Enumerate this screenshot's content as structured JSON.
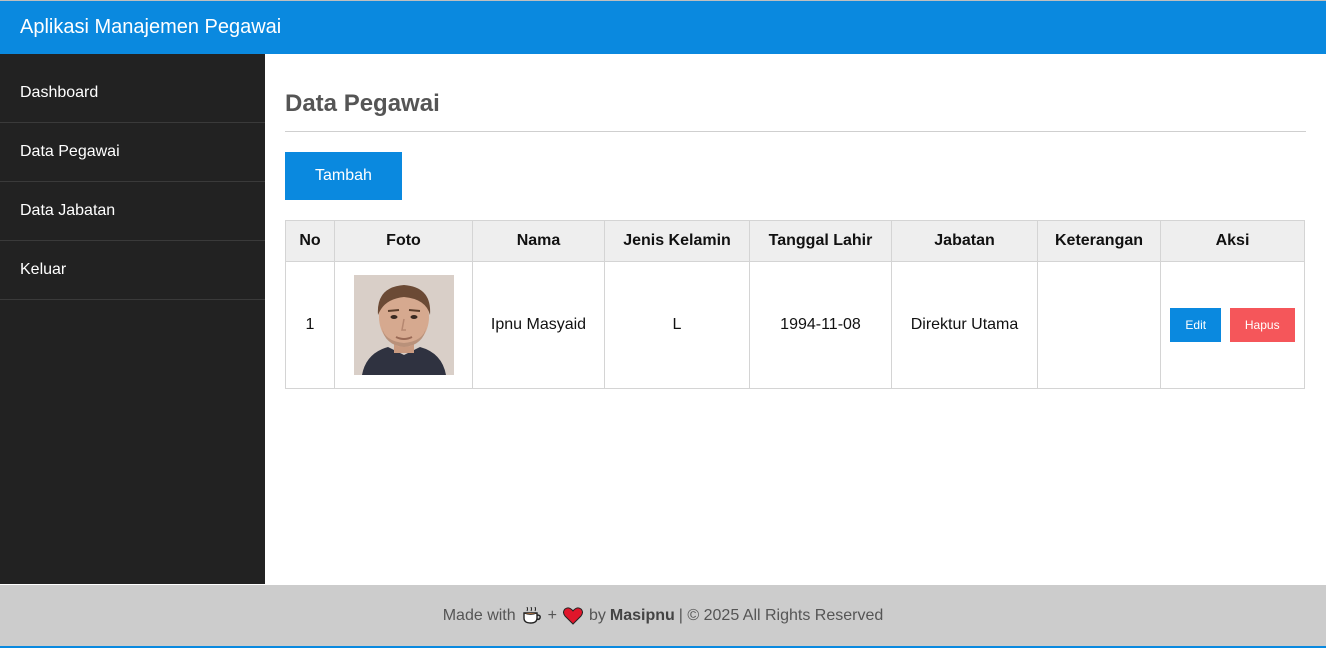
{
  "app": {
    "title": "Aplikasi Manajemen Pegawai"
  },
  "sidebar": {
    "items": [
      {
        "label": "Dashboard"
      },
      {
        "label": "Data Pegawai"
      },
      {
        "label": "Data Jabatan"
      },
      {
        "label": "Keluar"
      }
    ]
  },
  "main": {
    "title": "Data Pegawai",
    "add_button": "Tambah"
  },
  "table": {
    "headers": [
      "No",
      "Foto",
      "Nama",
      "Jenis Kelamin",
      "Tanggal Lahir",
      "Jabatan",
      "Keterangan",
      "Aksi"
    ],
    "rows": [
      {
        "no": "1",
        "nama": "Ipnu Masyaid",
        "jenis_kelamin": "L",
        "tanggal_lahir": "1994-11-08",
        "jabatan": "Direktur Utama",
        "keterangan": "",
        "edit_label": "Edit",
        "delete_label": "Hapus"
      }
    ]
  },
  "footer": {
    "prefix": "Made with",
    "plus": "+",
    "by": "by",
    "author": "Masipnu",
    "suffix": "| © 2025 All Rights Reserved"
  },
  "icons": {
    "coffee": "coffee-icon",
    "heart": "heart-icon"
  },
  "colors": {
    "primary": "#0a89df",
    "danger": "#f5565a",
    "sidebar": "#222222",
    "footer": "#cccccc"
  }
}
